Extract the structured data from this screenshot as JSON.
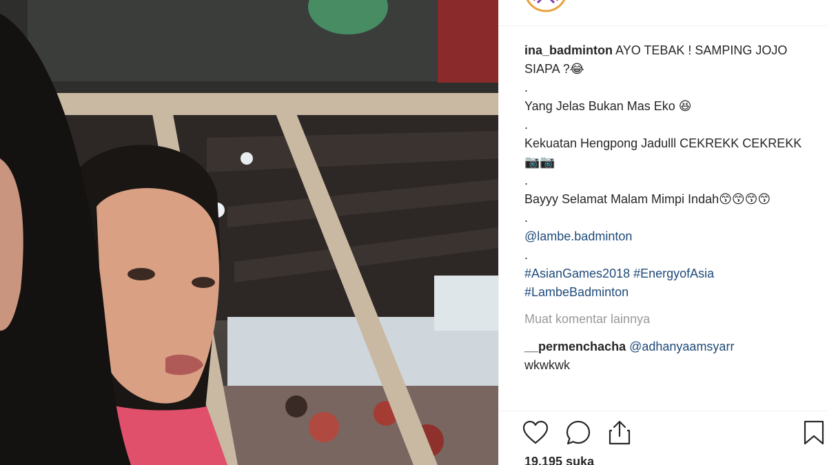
{
  "post": {
    "username": "ina_badminton",
    "caption_line1": "AYO TEBAK ! SAMPING JOJO SIAPA ?😂",
    "dot": ".",
    "line2": "Yang Jelas Bukan Mas Eko 😆",
    "line3": "Kekuatan Hengpong Jadulll CEKREKK CEKREKK 📷📷",
    "line4": "Bayyy Selamat Malam Mimpi Indah😙😙😙😙",
    "mention": "@lambe.badminton",
    "hashtags_line1": "#AsianGames2018 #EnergyofAsia",
    "hashtags_line2": "#LambeBadminton"
  },
  "more_comments": "Muat komentar lainnya",
  "reply": {
    "username": "__permenchacha",
    "mention": "@adhanyaamsyarr",
    "text": "wkwkwk"
  },
  "likes": "19.195 suka",
  "icons": {
    "like": "heart-icon",
    "comment": "comment-bubble-icon",
    "share": "share-icon",
    "save": "bookmark-icon"
  },
  "colors": {
    "link": "#1e4a79",
    "muted": "#999999",
    "text": "#262626"
  }
}
